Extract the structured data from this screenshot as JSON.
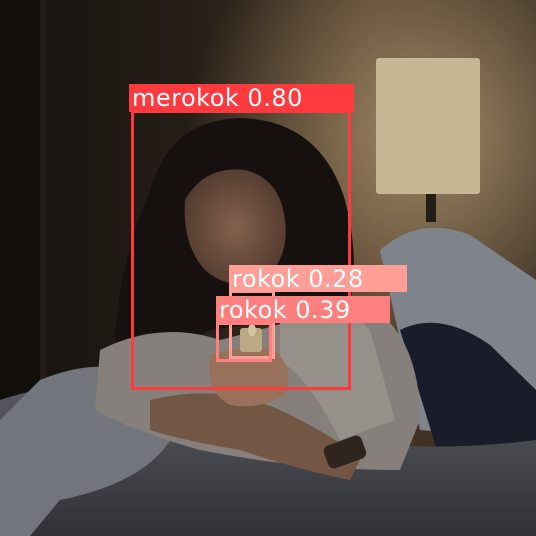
{
  "detections": [
    {
      "label": "merokok 0.80",
      "class": "merokok",
      "confidence": 0.8,
      "color": "#ff3a3f"
    },
    {
      "label": "rokok 0.28",
      "class": "rokok",
      "confidence": 0.28,
      "color": "#ff9d97"
    },
    {
      "label": "rokok 0.39",
      "class": "rokok",
      "confidence": 0.39,
      "color": "#ff7f7f"
    }
  ],
  "scene": {
    "palette": {
      "wall_dark": "#1e1915",
      "wall_warm": "#6b5236",
      "lamp_shade": "#f3e2b8",
      "pillow": "#9ea3ad",
      "hair": "#1c1412",
      "skin": "#b7876b",
      "shirt": "#a8a29d"
    }
  }
}
